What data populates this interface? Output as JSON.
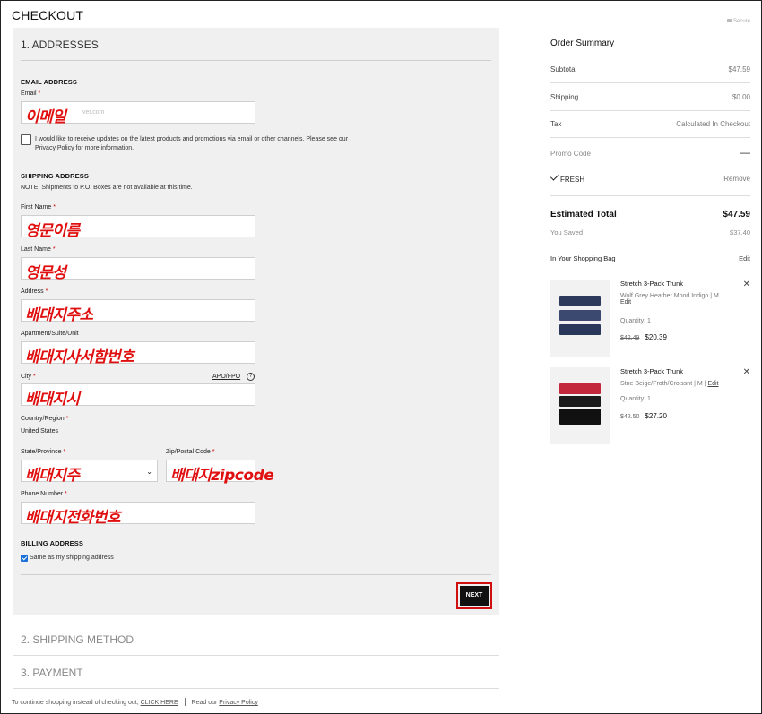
{
  "header": {
    "title": "CHECKOUT",
    "secure": "Secure"
  },
  "addresses": {
    "step_title": "1. ADDRESSES",
    "email_section": "EMAIL ADDRESS",
    "email_label": "Email",
    "email_value": "이메일",
    "email_ghost": "ver.com",
    "updates_text": "I would like to receive updates on the latest products and promotions via email or other channels. Please see our",
    "privacy_link": "Privacy Policy",
    "updates_tail": "for more information.",
    "shipping_section": "SHIPPING ADDRESS",
    "shipping_note": "NOTE: Shipments to P.O. Boxes are not available at this time.",
    "first_name_label": "First Name",
    "first_name_value": "영문이름",
    "last_name_label": "Last Name",
    "last_name_value": "영문성",
    "address_label": "Address",
    "address_value": "배대지주소",
    "apt_label": "Apartment/Suite/Unit",
    "apt_value": "배대지사서함번호",
    "city_label": "City",
    "city_value": "배대지시",
    "apo_link": "APO/FPO",
    "country_label": "Country/Region",
    "country_value": "United States",
    "state_label": "State/Province",
    "state_value": "배대지주",
    "zip_label": "Zip/Postal Code",
    "zip_value": "배대지zipcode",
    "phone_label": "Phone Number",
    "phone_value": "배대지전화번호",
    "billing_section": "BILLING ADDRESS",
    "same_as_shipping": "Same as my shipping address",
    "next_label": "NEXT",
    "required_mark": "*",
    "help_mark": "?"
  },
  "steps": {
    "shipping_method": "2. SHIPPING METHOD",
    "payment": "3. PAYMENT"
  },
  "footer": {
    "continue_text": "To continue shopping instead of checking out,",
    "click_here": "CLICK HERE",
    "read_text": "Read our",
    "privacy": "Privacy Policy"
  },
  "summary": {
    "title": "Order Summary",
    "subtotal_label": "Subtotal",
    "subtotal_value": "$47.59",
    "shipping_label": "Shipping",
    "shipping_value": "$0.00",
    "tax_label": "Tax",
    "tax_value": "Calculated In Checkout",
    "promo_label": "Promo Code",
    "promo_code": "FRESH",
    "promo_remove": "Remove",
    "estimated_label": "Estimated Total",
    "estimated_value": "$47.59",
    "saved_label": "You Saved",
    "saved_value": "$37.40",
    "bag_label": "In Your Shopping Bag",
    "bag_edit": "Edit",
    "items": [
      {
        "name": "Stretch 3-Pack Trunk",
        "variant": "Wolf Grey Heather Mood Indigo",
        "size": "M",
        "edit": "Edit",
        "quantity": "Quantity: 1",
        "original_price": "$42.49",
        "price": "$20.39",
        "colors": [
          "#2d3a5c",
          "#3b4870",
          "#29375a"
        ]
      },
      {
        "name": "Stretch 3-Pack Trunk",
        "variant": "Stne Beige/Froth/Croissnt",
        "size": "M",
        "edit": "Edit",
        "quantity": "Quantity: 1",
        "original_price": "$42.50",
        "price": "$27.20",
        "colors": [
          "#c2273b",
          "#1b1b1b",
          "#111111"
        ]
      }
    ]
  },
  "colors": {
    "accent_red": "#d01010",
    "button_dark": "#111111",
    "panel_bg": "#f0f0f0"
  }
}
